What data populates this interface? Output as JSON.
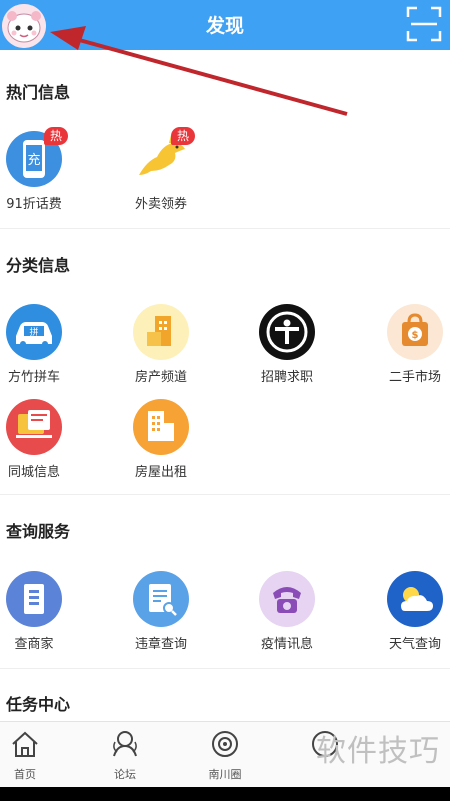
{
  "header": {
    "title": "发现"
  },
  "sections": {
    "hot": {
      "title": "热门信息",
      "items": [
        {
          "label": "91折话费",
          "badge": "热",
          "icon": "充"
        },
        {
          "label": "外卖领券",
          "badge": "热"
        }
      ]
    },
    "category": {
      "title": "分类信息",
      "items": [
        {
          "label": "方竹拼车",
          "icon_text": "拼"
        },
        {
          "label": "房产频道"
        },
        {
          "label": "招聘求职"
        },
        {
          "label": "二手市场",
          "icon_text": "$"
        },
        {
          "label": "同城信息"
        },
        {
          "label": "房屋出租"
        }
      ]
    },
    "query": {
      "title": "查询服务",
      "items": [
        {
          "label": "查商家"
        },
        {
          "label": "违章查询"
        },
        {
          "label": "疫情讯息"
        },
        {
          "label": "天气查询"
        }
      ]
    },
    "task": {
      "title": "任务中心"
    }
  },
  "tabs": [
    {
      "label": "首页"
    },
    {
      "label": "论坛"
    },
    {
      "label": "南川圈"
    }
  ],
  "watermark": "软件技巧"
}
